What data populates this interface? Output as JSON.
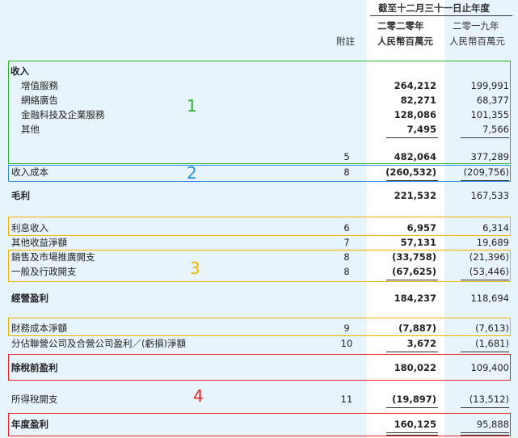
{
  "header": {
    "period": "截至十二月三十一日止年度",
    "year_2020": "二零二零年",
    "year_2019": "二零一九年",
    "unit_2020": "人民幣百萬元",
    "unit_2019": "人民幣百萬元",
    "note_col": "附註"
  },
  "rows": [
    {
      "label": "收入",
      "note": "",
      "v2020": "",
      "v2019": ""
    },
    {
      "label": "增值服務",
      "note": "",
      "v2020": "264,212",
      "v2019": "199,991"
    },
    {
      "label": "網絡廣告",
      "note": "",
      "v2020": "82,271",
      "v2019": "68,377"
    },
    {
      "label": "金融科技及企業服務",
      "note": "",
      "v2020": "128,086",
      "v2019": "101,355"
    },
    {
      "label": "其他",
      "note": "",
      "v2020": "7,495",
      "v2019": "7,566"
    },
    {
      "label": "",
      "note": "5",
      "v2020": "482,064",
      "v2019": "377,289"
    },
    {
      "label": "收入成本",
      "note": "8",
      "v2020": "(260,532)",
      "v2019": "(209,756)"
    },
    {
      "label": "毛利",
      "note": "",
      "v2020": "221,532",
      "v2019": "167,533"
    },
    {
      "label": "利息收入",
      "note": "6",
      "v2020": "6,957",
      "v2019": "6,314"
    },
    {
      "label": "其他收益淨額",
      "note": "7",
      "v2020": "57,131",
      "v2019": "19,689"
    },
    {
      "label": "銷售及市場推廣開支",
      "note": "8",
      "v2020": "(33,758)",
      "v2019": "(21,396)"
    },
    {
      "label": "一般及行政開支",
      "note": "8",
      "v2020": "(67,625)",
      "v2019": "(53,446)"
    },
    {
      "label": "經營盈利",
      "note": "",
      "v2020": "184,237",
      "v2019": "118,694"
    },
    {
      "label": "財務成本淨額",
      "note": "9",
      "v2020": "(7,887)",
      "v2019": "(7,613)"
    },
    {
      "label": "分佔聯營公司及合營公司盈利／(虧損)淨額",
      "note": "10",
      "v2020": "3,672",
      "v2019": "(1,681)"
    },
    {
      "label": "除稅前盈利",
      "note": "",
      "v2020": "180,022",
      "v2019": "109,400"
    },
    {
      "label": "所得稅開支",
      "note": "11",
      "v2020": "(19,897)",
      "v2019": "(13,512)"
    },
    {
      "label": "年度盈利",
      "note": "",
      "v2020": "160,125",
      "v2019": "95,888"
    }
  ],
  "annotations": {
    "a1": "1",
    "a2": "2",
    "a3": "3",
    "a4": "4"
  },
  "colors": {
    "green": "#2db52d",
    "blue": "#2a8fe0",
    "orange": "#f0b400",
    "red": "#e8231e",
    "bg": "#e8f4fb"
  }
}
